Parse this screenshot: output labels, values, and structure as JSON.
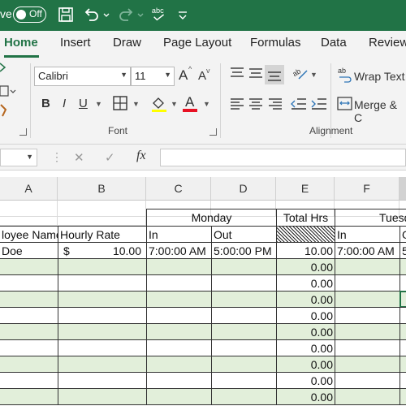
{
  "titlebar": {
    "autosave_label": "ve",
    "toggle_state": "Off"
  },
  "tabs": [
    "Home",
    "Insert",
    "Draw",
    "Page Layout",
    "Formulas",
    "Data",
    "Review"
  ],
  "ribbon": {
    "font_name": "Calibri",
    "font_size": "11",
    "bold": "B",
    "italic": "I",
    "underline": "U",
    "grow_font": "A",
    "shrink_font": "A",
    "font_color": "A",
    "font_group_label": "Font",
    "alignment_group_label": "Alignment",
    "wrap_text": "Wrap Text",
    "merge_center": "Merge & C",
    "font_color_bar": "#e81123"
  },
  "formula_bar": {
    "cancel": "✕",
    "enter": "✓",
    "fx": "fx",
    "value": ""
  },
  "columns": [
    "A",
    "B",
    "C",
    "D",
    "E",
    "F"
  ],
  "headers": {
    "monday": "Monday",
    "total_hrs": "Total Hrs",
    "tuesday": "Tuesd"
  },
  "subheaders": {
    "employee_name": "loyee Name",
    "hourly_rate": "Hourly Rate",
    "in": "In",
    "out": "Out",
    "in2": "In",
    "extra": "O"
  },
  "rows": [
    {
      "name": "Doe",
      "currency": "$",
      "rate": "10.00",
      "in": "7:00:00 AM",
      "out": "5:00:00 PM",
      "total": "10.00",
      "tue_in": "7:00:00 AM",
      "extra": "5"
    },
    {
      "total": "0.00"
    },
    {
      "total": "0.00"
    },
    {
      "total": "0.00"
    },
    {
      "total": "0.00"
    },
    {
      "total": "0.00"
    },
    {
      "total": "0.00"
    },
    {
      "total": "0.00"
    },
    {
      "total": "0.00"
    },
    {
      "total": "0.00"
    }
  ],
  "colors": {
    "brand": "#217346",
    "band": "#e2efda"
  }
}
